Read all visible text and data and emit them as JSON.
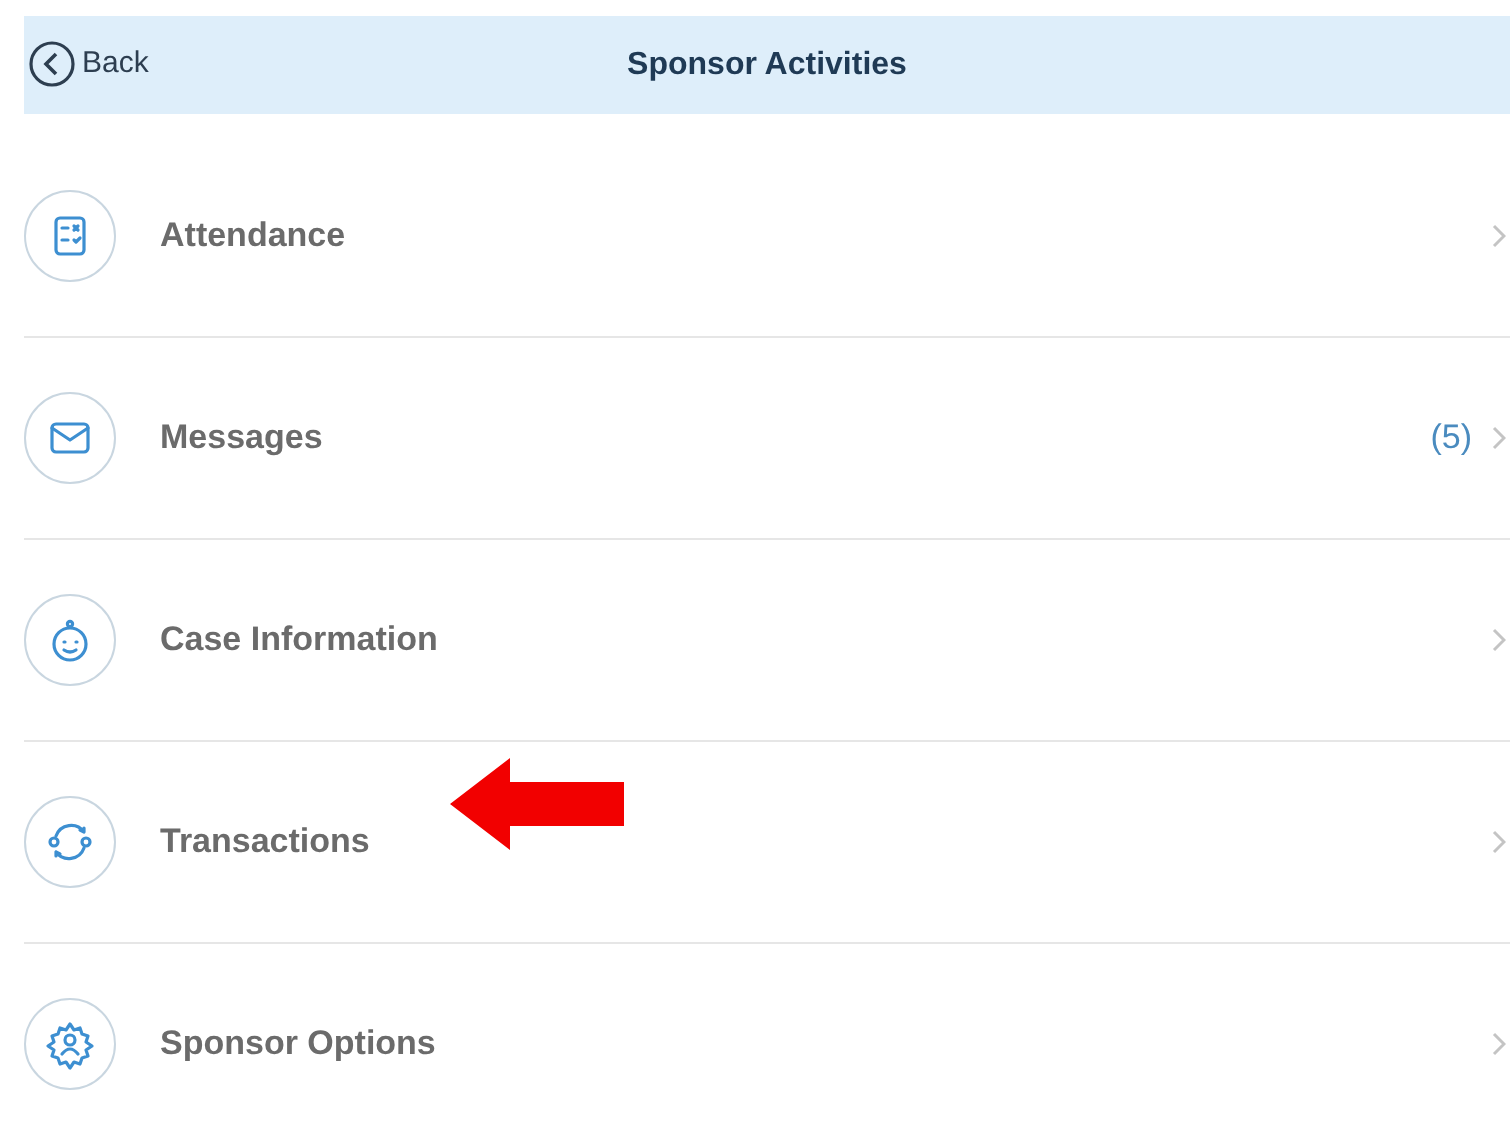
{
  "header": {
    "back": "Back",
    "title": "Sponsor Activities"
  },
  "items": [
    {
      "label": "Attendance"
    },
    {
      "label": "Messages",
      "count": "(5)"
    },
    {
      "label": "Case Information"
    },
    {
      "label": "Transactions"
    },
    {
      "label": "Sponsor Options"
    }
  ]
}
